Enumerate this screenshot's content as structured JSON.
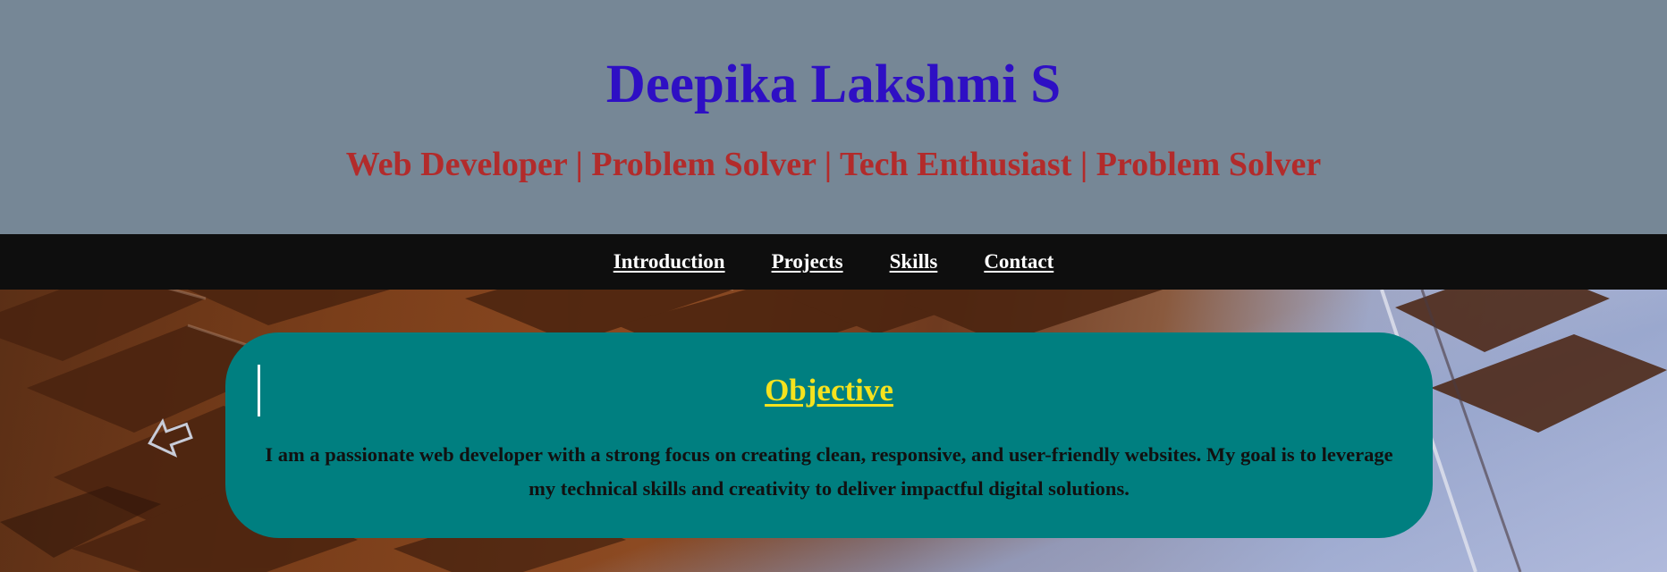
{
  "header": {
    "name": "Deepika Lakshmi S",
    "tagline": "Web Developer | Problem Solver | Tech Enthusiast | Problem Solver"
  },
  "nav": {
    "items": [
      {
        "label": "Introduction"
      },
      {
        "label": "Projects"
      },
      {
        "label": "Skills"
      },
      {
        "label": "Contact"
      }
    ]
  },
  "objective": {
    "heading": "Objective",
    "text": "I am a passionate web developer with a strong focus on creating clean, responsive, and user-friendly websites. My goal is to leverage my technical skills and creativity to deliver impactful digital solutions."
  },
  "colors": {
    "header_bg": "#768796",
    "title": "#2e0fc4",
    "tagline": "#b22b2b",
    "nav_bg": "#0e0e0e",
    "card_bg": "#007f80",
    "card_heading": "#f5e21e"
  }
}
